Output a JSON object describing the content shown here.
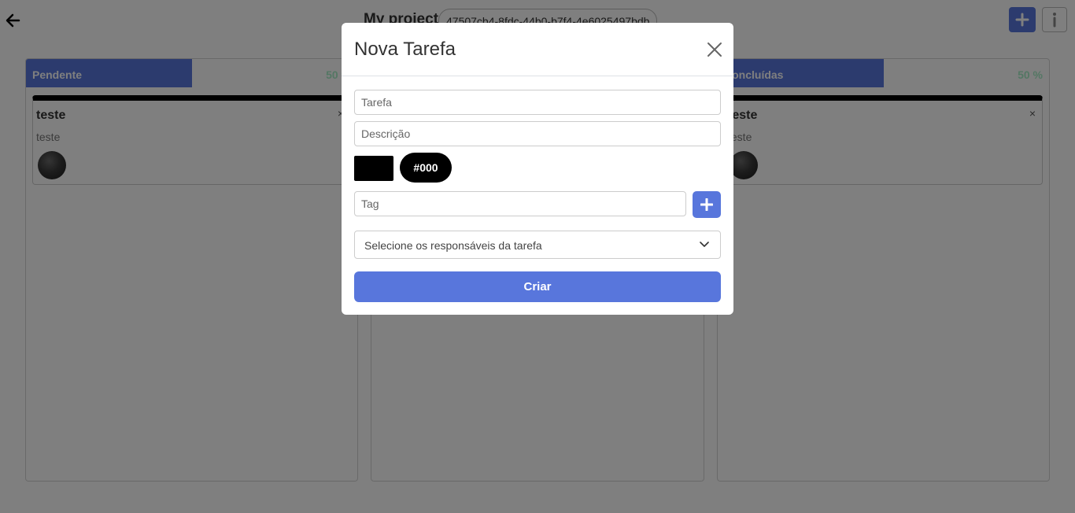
{
  "header": {
    "project_title": "My project",
    "project_id": "47507cb4-8fdc-44b0-b7f4-4e6025497bdb",
    "icons": {
      "back": "arrow-left-icon",
      "add": "plus-icon",
      "info": "info-icon"
    }
  },
  "columns": [
    {
      "name": "Pendente",
      "percent": "50 %",
      "fill": 0.5,
      "card": {
        "title": "teste",
        "description": "teste",
        "close": "×"
      }
    },
    {
      "name": "",
      "percent": "",
      "fill": 0,
      "card": null
    },
    {
      "name": "Concluídas",
      "percent": "50 %",
      "fill": 0.5,
      "card": {
        "title": "teste",
        "description": "teste",
        "close": "×"
      }
    }
  ],
  "modal": {
    "title": "Nova Tarefa",
    "task_placeholder": "Tarefa",
    "description_placeholder": "Descrição",
    "color_value": "#000",
    "color_hex": "#000000",
    "tag_placeholder": "Tag",
    "assignees_placeholder": "Selecione os responsáveis da tarefa",
    "submit_label": "Criar"
  },
  "colors": {
    "accent": "#5876dc",
    "progress_text": "#a9eec8",
    "overlay": "rgba(0,0,0,0.5)"
  }
}
